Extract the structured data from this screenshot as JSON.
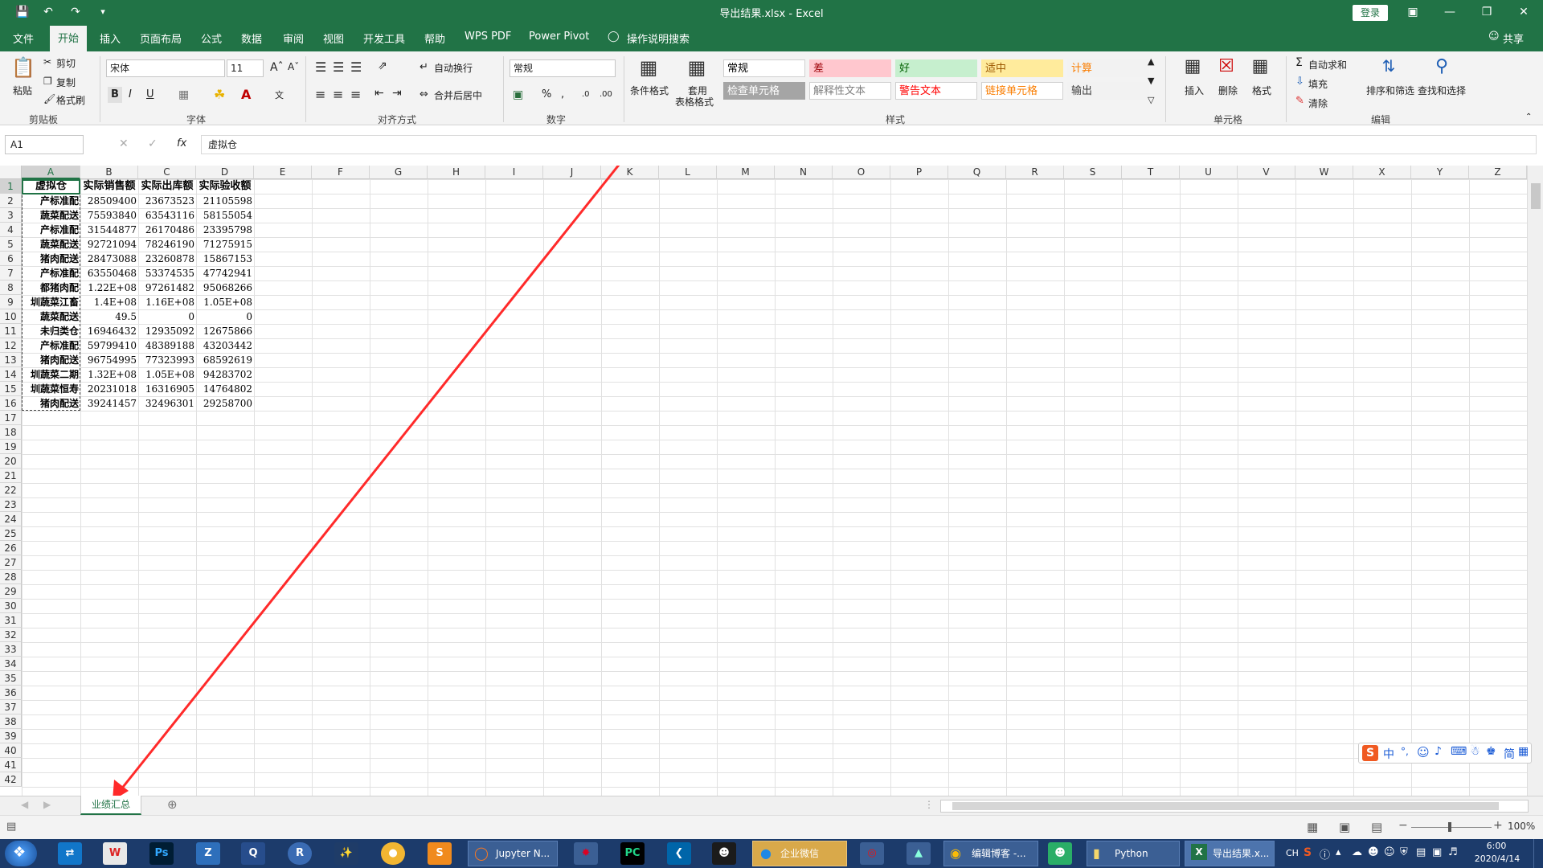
{
  "window": {
    "title": "导出结果.xlsx - Excel",
    "login_label": "登录",
    "share_label": "共享"
  },
  "menu": {
    "items": [
      "文件",
      "开始",
      "插入",
      "页面布局",
      "公式",
      "数据",
      "审阅",
      "视图",
      "开发工具",
      "帮助",
      "WPS PDF",
      "Power Pivot"
    ],
    "search_label": "操作说明搜索"
  },
  "ribbon": {
    "clipboard": {
      "paste": "粘贴",
      "cut": "剪切",
      "copy": "复制",
      "format_painter": "格式刷",
      "group": "剪贴板"
    },
    "font": {
      "name": "宋体",
      "size": "11",
      "group": "字体",
      "bold": "B",
      "italic": "I",
      "underline": "U"
    },
    "alignment": {
      "wrap": "自动换行",
      "merge": "合并后居中",
      "group": "对齐方式"
    },
    "number": {
      "format": "常规",
      "percent": "%",
      "group": "数字"
    },
    "styles": {
      "conditional": "条件格式",
      "table_format_1": "套用",
      "table_format_2": "表格格式",
      "cells": [
        {
          "label": "常规",
          "bg": "#ffffff",
          "fg": "#000000"
        },
        {
          "label": "差",
          "bg": "#ffc7ce",
          "fg": "#9c0006"
        },
        {
          "label": "好",
          "bg": "#c6efce",
          "fg": "#006100"
        },
        {
          "label": "适中",
          "bg": "#ffeb9c",
          "fg": "#9c5700"
        },
        {
          "label": "计算",
          "bg": "#f2f2f2",
          "fg": "#fa7d00"
        },
        {
          "label": "检查单元格",
          "bg": "#a5a5a5",
          "fg": "#ffffff"
        },
        {
          "label": "解释性文本",
          "bg": "#ffffff",
          "fg": "#7f7f7f"
        },
        {
          "label": "警告文本",
          "bg": "#ffffff",
          "fg": "#ff0000"
        },
        {
          "label": "链接单元格",
          "bg": "#ffffff",
          "fg": "#fa7d00"
        },
        {
          "label": "输出",
          "bg": "#f2f2f2",
          "fg": "#3f3f3f"
        }
      ],
      "group": "样式"
    },
    "cells_group": {
      "insert": "插入",
      "delete": "删除",
      "format": "格式",
      "group": "单元格"
    },
    "editing": {
      "autosum": "自动求和",
      "fill": "填充",
      "clear": "清除",
      "sort": "排序和筛选",
      "find": "查找和选择",
      "group": "编辑"
    }
  },
  "formula_bar": {
    "name_box": "A1",
    "fx": "fx",
    "content": "虚拟仓"
  },
  "sheet": {
    "columns": [
      "A",
      "B",
      "C",
      "D",
      "E",
      "F",
      "G",
      "H",
      "I",
      "J",
      "K",
      "L",
      "M",
      "N",
      "O",
      "P",
      "Q",
      "R",
      "S",
      "T",
      "U",
      "V",
      "W",
      "X",
      "Y",
      "Z"
    ],
    "row_count": 42,
    "headers": [
      "虚拟仓",
      "实际销售额",
      "实际出库额",
      "实际验收额"
    ],
    "rows": [
      [
        "产标准配",
        "28509400",
        "23673523",
        "21105598"
      ],
      [
        "蔬菜配送",
        "75593840",
        "63543116",
        "58155054"
      ],
      [
        "产标准配",
        "31544877",
        "26170486",
        "23395798"
      ],
      [
        "蔬菜配送",
        "92721094",
        "78246190",
        "71275915"
      ],
      [
        "猪肉配送",
        "28473088",
        "23260878",
        "15867153"
      ],
      [
        "产标准配",
        "63550468",
        "53374535",
        "47742941"
      ],
      [
        "都猪肉配",
        "1.22E+08",
        "97261482",
        "95068266"
      ],
      [
        "圳蔬菜江畜",
        "1.4E+08",
        "1.16E+08",
        "1.05E+08"
      ],
      [
        "蔬菜配送",
        "49.5",
        "0",
        "0"
      ],
      [
        "未归类仓",
        "16946432",
        "12935092",
        "12675866"
      ],
      [
        "产标准配",
        "59799410",
        "48389188",
        "43203442"
      ],
      [
        "猪肉配送",
        "96754995",
        "77323993",
        "68592619"
      ],
      [
        "圳蔬菜二期",
        "1.32E+08",
        "1.05E+08",
        "94283702"
      ],
      [
        "圳蔬菜恒寿",
        "20231018",
        "16316905",
        "14764802"
      ],
      [
        "猪肉配送",
        "39241457",
        "32496301",
        "29258700"
      ]
    ]
  },
  "tabs": {
    "active": "业绩汇总"
  },
  "status": {
    "zoom": "100%"
  },
  "ime": {
    "items": [
      "中",
      "简"
    ]
  },
  "taskbar": {
    "tasks": [
      "Jupyter N...",
      "企业微信",
      "编辑博客 -...",
      "Python",
      "导出结果.x..."
    ],
    "tray_lang": "CH",
    "time": "6:00",
    "date": "2020/4/14"
  }
}
